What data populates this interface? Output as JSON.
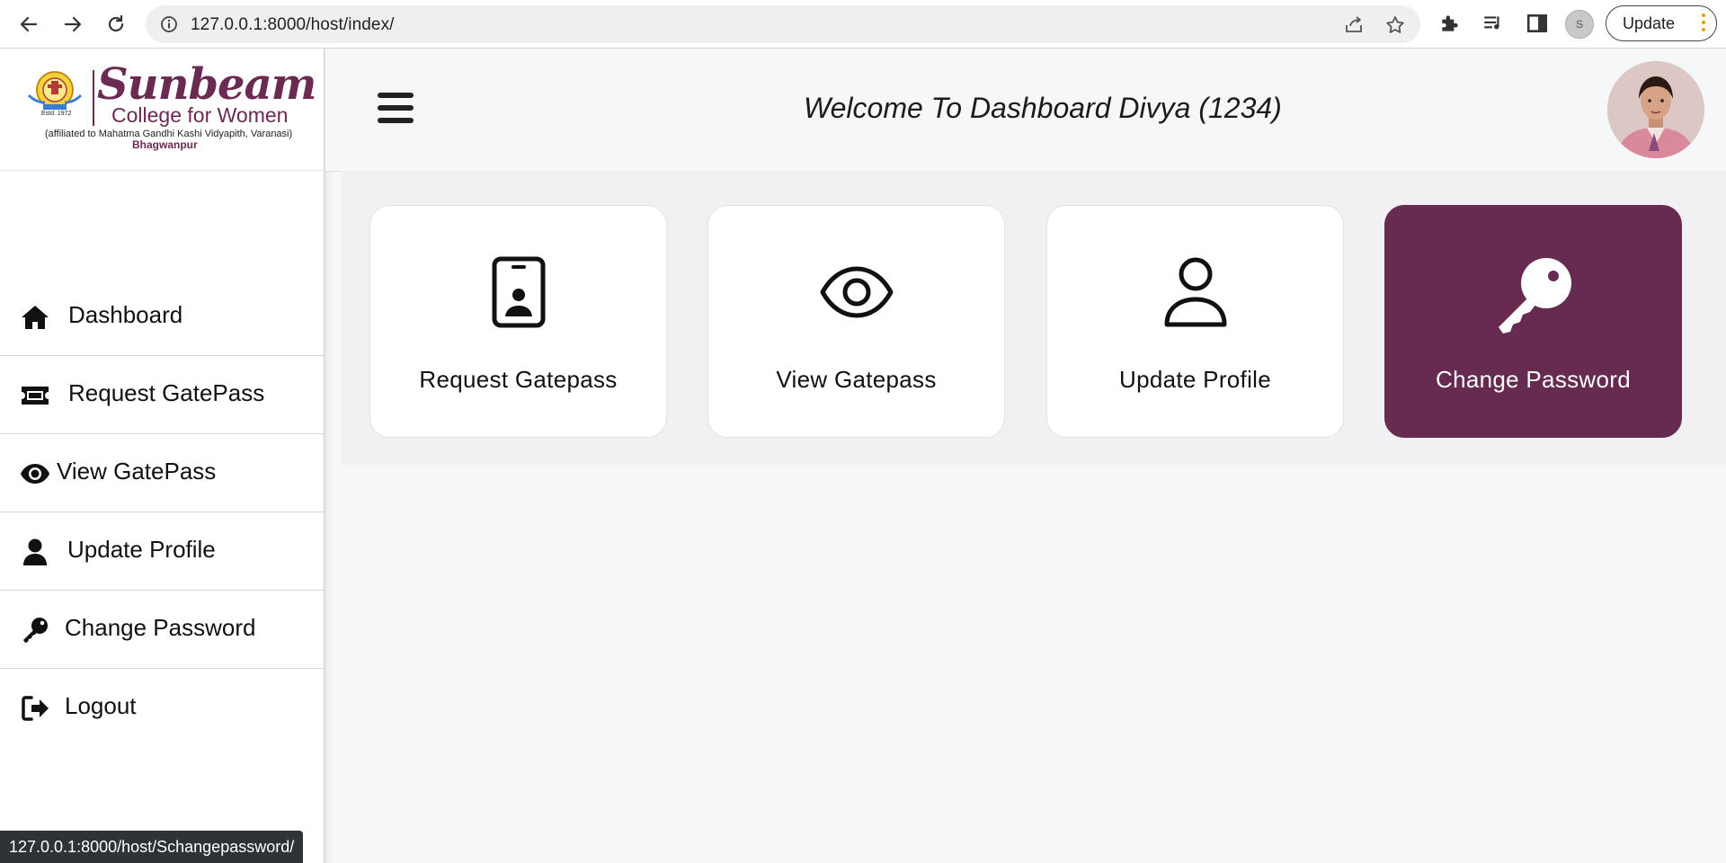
{
  "browser": {
    "url": "127.0.0.1:8000/host/index/",
    "update_label": "Update",
    "profile_initial": "S"
  },
  "logo": {
    "title": "Sunbeam",
    "subtitle": "College for Women",
    "affiliation": "(affiliated to Mahatma Gandhi Kashi Vidyapith, Varanasi)",
    "place": "Bhagwanpur",
    "estd": "Estd. 1972"
  },
  "sidebar": {
    "items": [
      {
        "label": "Dashboard",
        "icon": "home-icon"
      },
      {
        "label": "Request GatePass",
        "icon": "ticket-icon"
      },
      {
        "label": "View GatePass",
        "icon": "eye-icon"
      },
      {
        "label": "Update Profile",
        "icon": "user-icon"
      },
      {
        "label": "Change Password",
        "icon": "key-icon"
      },
      {
        "label": "Logout",
        "icon": "logout-icon"
      }
    ]
  },
  "header": {
    "welcome": "Welcome To Dashboard Divya (1234)"
  },
  "cards": [
    {
      "label": "Request Gatepass",
      "icon": "id-badge-icon"
    },
    {
      "label": "View Gatepass",
      "icon": "eye-icon"
    },
    {
      "label": "Update Profile",
      "icon": "user-icon"
    },
    {
      "label": "Change Password",
      "icon": "key-icon",
      "active": true
    }
  ],
  "colors": {
    "brand": "#672a50",
    "background": "#f6f7f9"
  },
  "status_bar": {
    "link_preview": "127.0.0.1:8000/host/Schangepassword/"
  }
}
